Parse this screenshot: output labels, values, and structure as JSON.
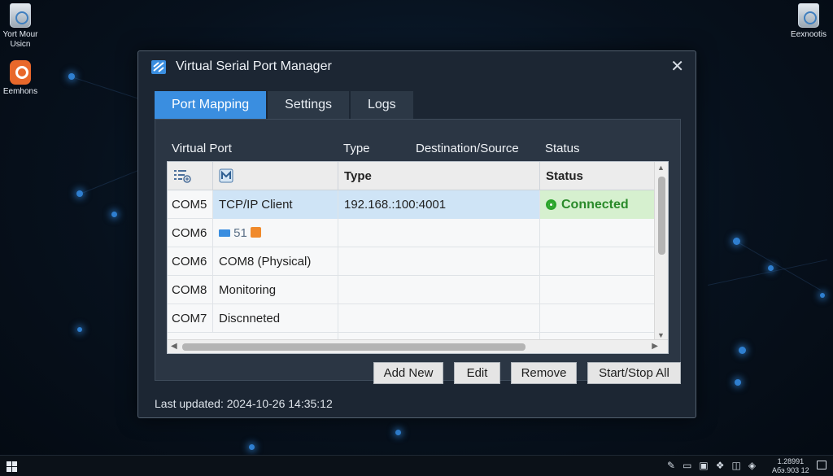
{
  "desktop": {
    "icons": [
      {
        "label": "Yort Mour Usicn"
      },
      {
        "label": "Eemhons"
      },
      {
        "label": "Eexnootis"
      }
    ]
  },
  "window": {
    "title": "Virtual Serial Port Manager",
    "close_glyph": "✕",
    "tabs": [
      {
        "label": "Port Mapping",
        "active": true
      },
      {
        "label": "Settings",
        "active": false
      },
      {
        "label": "Logs",
        "active": false
      }
    ],
    "columns": {
      "virtual_port": "Virtual Port",
      "type": "Type",
      "destination": "Destination/Source",
      "status": "Status"
    },
    "grid": {
      "header": {
        "col1_icon": "list-add-icon",
        "col2_icon": "port-icon",
        "col3": "Type",
        "col4": "Status"
      },
      "rows": [
        {
          "port": "COM5",
          "type": "TCP/IP Client",
          "dest": "192.168.:100:4001",
          "status": "Connected",
          "selected": true
        },
        {
          "port": "COM6",
          "type": "51",
          "dest": "",
          "status": "",
          "selected": false
        },
        {
          "port": "COM6",
          "type": "COM8 (Physical)",
          "dest": "",
          "status": "",
          "selected": false
        },
        {
          "port": "COM8",
          "type": "Monitoring",
          "dest": "",
          "status": "",
          "selected": false
        },
        {
          "port": "COM7",
          "type": "Discnneted",
          "dest": "",
          "status": "",
          "selected": false
        }
      ]
    },
    "buttons": {
      "add_new": "Add New",
      "edit": "Edit",
      "remove": "Remove",
      "start_stop_all": "Start/Stop All"
    },
    "footer": "Last updated: 2024-10-26 14:35:12"
  },
  "taskbar": {
    "clock_line1": "1.28991",
    "clock_line2": "Aбэ.903 12"
  },
  "colors": {
    "accent": "#3a8ee0",
    "connected": "#2a8a2a",
    "window_bg": "#1c2633"
  }
}
